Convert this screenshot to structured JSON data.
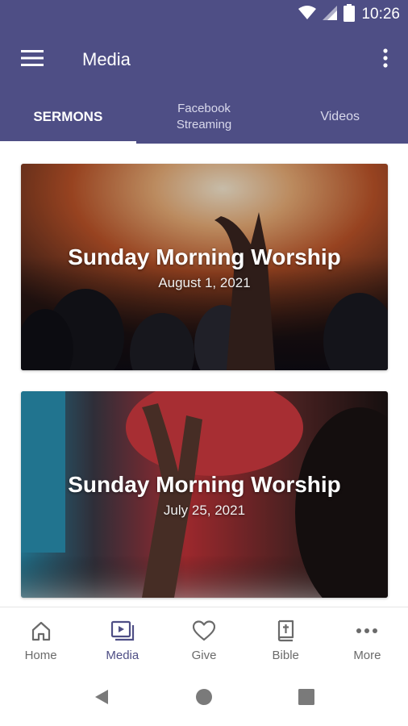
{
  "status_bar": {
    "time": "10:26",
    "icons": [
      "wifi-icon",
      "signal-icon",
      "battery-icon"
    ]
  },
  "app_bar": {
    "title": "Media",
    "menu_icon": "hamburger-menu-icon",
    "overflow_icon": "more-vertical-icon"
  },
  "tabs": [
    {
      "label": "SERMONS",
      "active": true
    },
    {
      "label_line1": "Facebook",
      "label_line2": "Streaming",
      "active": false
    },
    {
      "label": "Videos",
      "active": false
    }
  ],
  "cards": [
    {
      "title": "Sunday Morning Worship",
      "date": "August 1, 2021"
    },
    {
      "title": "Sunday Morning Worship",
      "date": "July 25, 2021"
    }
  ],
  "bottom_nav": [
    {
      "label": "Home",
      "icon": "home-icon",
      "active": false
    },
    {
      "label": "Media",
      "icon": "media-icon",
      "active": true
    },
    {
      "label": "Give",
      "icon": "heart-icon",
      "active": false
    },
    {
      "label": "Bible",
      "icon": "bible-icon",
      "active": false
    },
    {
      "label": "More",
      "icon": "more-horizontal-icon",
      "active": false
    }
  ],
  "colors": {
    "primary": "#4e4e85",
    "nav_inactive": "#6a6a6a",
    "background": "#ffffff"
  }
}
